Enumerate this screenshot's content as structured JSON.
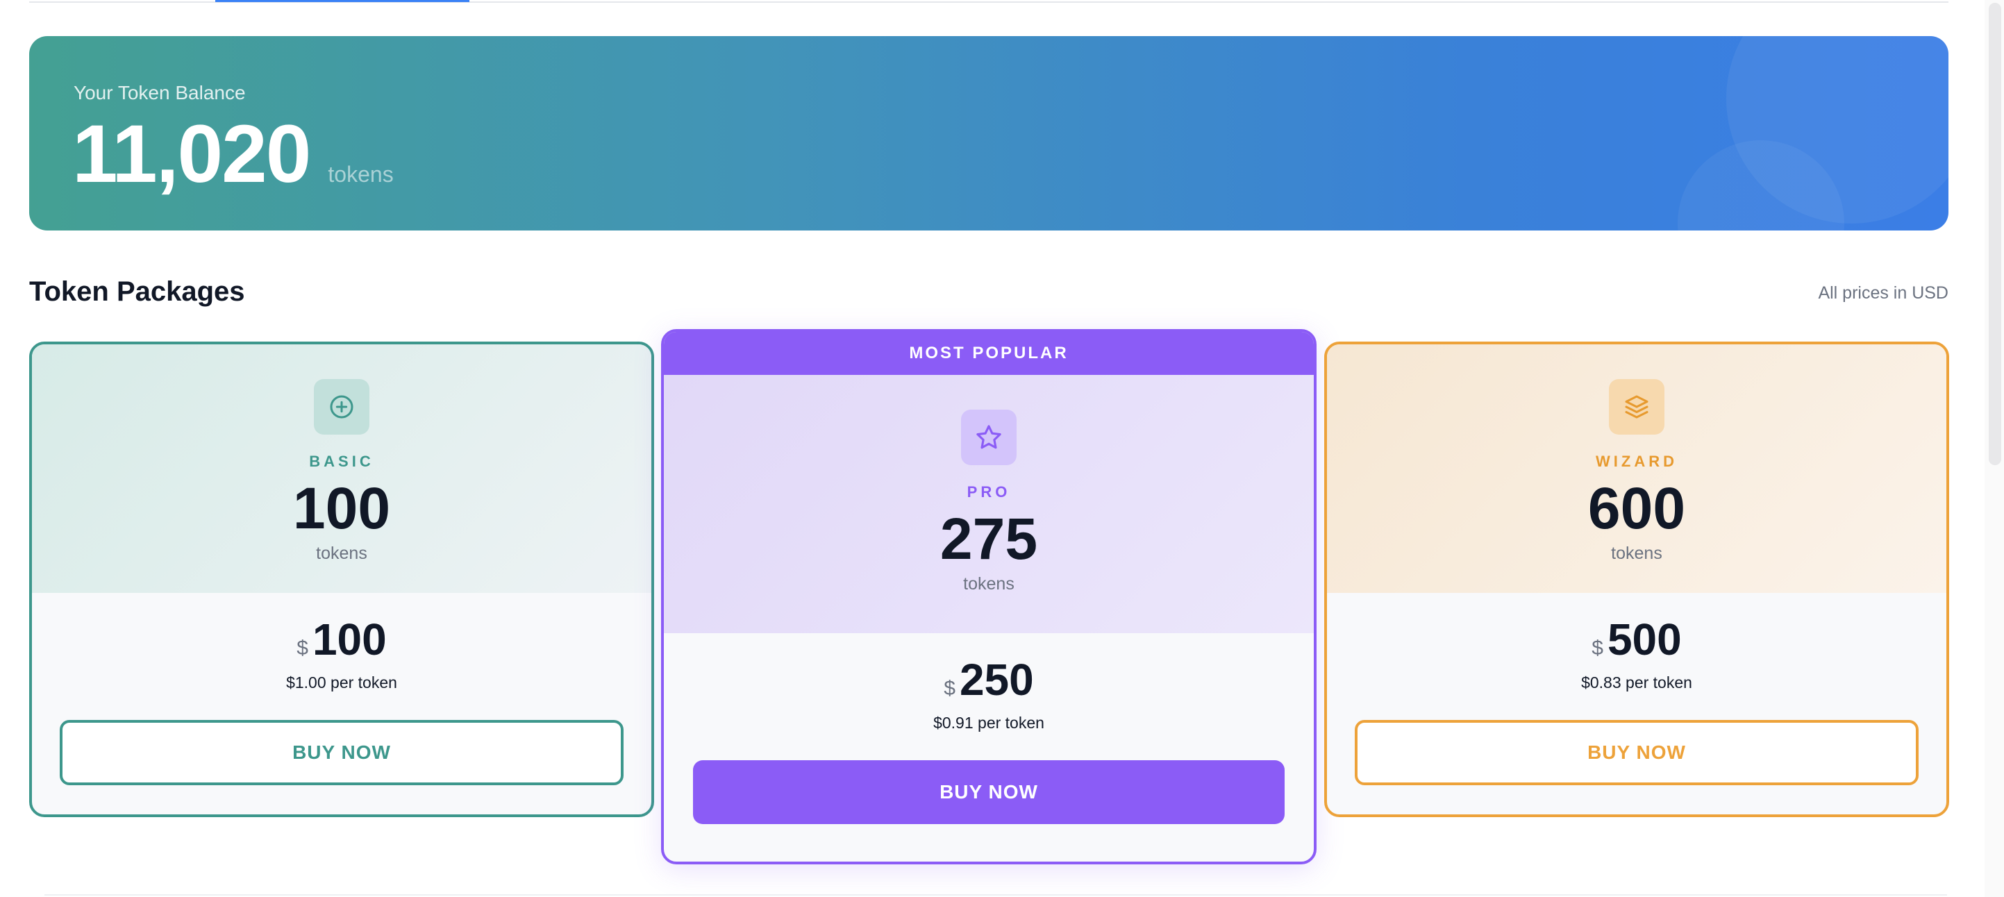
{
  "balance": {
    "label": "Your Token Balance",
    "value": "11,020",
    "unit": "tokens"
  },
  "section": {
    "title": "Token Packages",
    "note": "All prices in USD"
  },
  "packages": [
    {
      "tier": "BASIC",
      "tokens": "100",
      "token_unit": "tokens",
      "currency": "$",
      "price": "100",
      "per_token": "$1.00 per token",
      "button": "BUY NOW",
      "icon": "plus-circle-icon",
      "accent": "#3d978c"
    },
    {
      "badge": "MOST POPULAR",
      "tier": "PRO",
      "tokens": "275",
      "token_unit": "tokens",
      "currency": "$",
      "price": "250",
      "per_token": "$0.91 per token",
      "button": "BUY NOW",
      "icon": "star-icon",
      "accent": "#8b5cf6"
    },
    {
      "tier": "WIZARD",
      "tokens": "600",
      "token_unit": "tokens",
      "currency": "$",
      "price": "500",
      "per_token": "$0.83 per token",
      "button": "BUY NOW",
      "icon": "layers-icon",
      "accent": "#eda23a"
    }
  ]
}
